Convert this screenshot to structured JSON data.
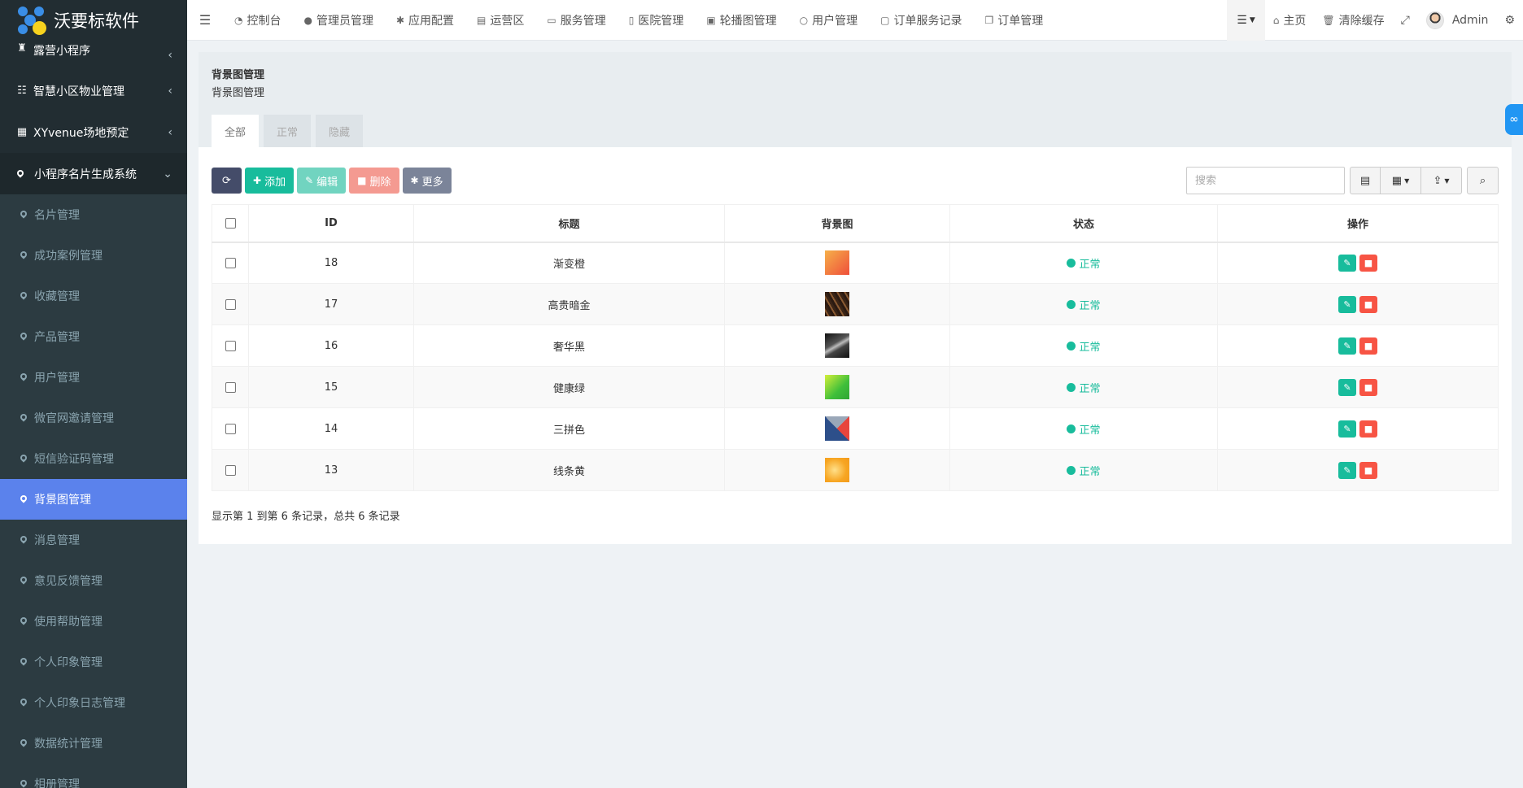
{
  "app": {
    "logo_text": "沃要标软件",
    "colors": {
      "sidebar_bg": "#222d32",
      "active_item": "#5b82ec",
      "success": "#18bc9c",
      "danger": "#f75444"
    }
  },
  "sidebar": {
    "groups": [
      {
        "label": "露营小程序",
        "icon": "camp-icon"
      },
      {
        "label": "智慧小区物业管理",
        "icon": "cubes-icon"
      },
      {
        "label": "XYvenue场地预定",
        "icon": "grid-icon"
      },
      {
        "label": "小程序名片生成系统",
        "icon": "map-pin-icon"
      }
    ],
    "items": [
      {
        "label": "名片管理"
      },
      {
        "label": "成功案例管理"
      },
      {
        "label": "收藏管理"
      },
      {
        "label": "产品管理"
      },
      {
        "label": "用户管理"
      },
      {
        "label": "微官网邀请管理"
      },
      {
        "label": "短信验证码管理"
      },
      {
        "label": "背景图管理",
        "active": true
      },
      {
        "label": "消息管理"
      },
      {
        "label": "意见反馈管理"
      },
      {
        "label": "使用帮助管理"
      },
      {
        "label": "个人印象管理"
      },
      {
        "label": "个人印象日志管理"
      },
      {
        "label": "数据统计管理"
      },
      {
        "label": "相册管理"
      }
    ]
  },
  "navbar": {
    "items": [
      {
        "label": "控制台",
        "icon": "dashboard-icon"
      },
      {
        "label": "管理员管理",
        "icon": "user-icon"
      },
      {
        "label": "应用配置",
        "icon": "gear-icon"
      },
      {
        "label": "运营区",
        "icon": "map-icon"
      },
      {
        "label": "服务管理",
        "icon": "list-alt-icon"
      },
      {
        "label": "医院管理",
        "icon": "clipboard-icon"
      },
      {
        "label": "轮播图管理",
        "icon": "image-icon"
      },
      {
        "label": "用户管理",
        "icon": "user-outline-icon"
      },
      {
        "label": "订单服务记录",
        "icon": "save-icon"
      },
      {
        "label": "订单管理",
        "icon": "copy-icon"
      }
    ],
    "home": "主页",
    "clear_cache": "清除缓存",
    "admin": "Admin"
  },
  "page": {
    "title": "背景图管理",
    "subtitle": "背景图管理",
    "tabs": [
      {
        "label": "全部",
        "active": true
      },
      {
        "label": "正常"
      },
      {
        "label": "隐藏"
      }
    ]
  },
  "toolbar": {
    "add": "添加",
    "edit": "编辑",
    "delete": "删除",
    "more": "更多",
    "search_placeholder": "搜索"
  },
  "table": {
    "headers": [
      "ID",
      "标题",
      "背景图",
      "状态",
      "操作"
    ],
    "rows": [
      {
        "id": "18",
        "title": "渐变橙",
        "status": "正常",
        "thumb": "orange-gradient"
      },
      {
        "id": "17",
        "title": "高贵暗金",
        "status": "正常",
        "thumb": "dark-gold"
      },
      {
        "id": "16",
        "title": "奢华黑",
        "status": "正常",
        "thumb": "luxury-black"
      },
      {
        "id": "15",
        "title": "健康绿",
        "status": "正常",
        "thumb": "health-green"
      },
      {
        "id": "14",
        "title": "三拼色",
        "status": "正常",
        "thumb": "tri-color"
      },
      {
        "id": "13",
        "title": "线条黄",
        "status": "正常",
        "thumb": "line-yellow"
      }
    ]
  },
  "pagination": {
    "info": "显示第 1 到第 6 条记录，总共 6 条记录"
  }
}
